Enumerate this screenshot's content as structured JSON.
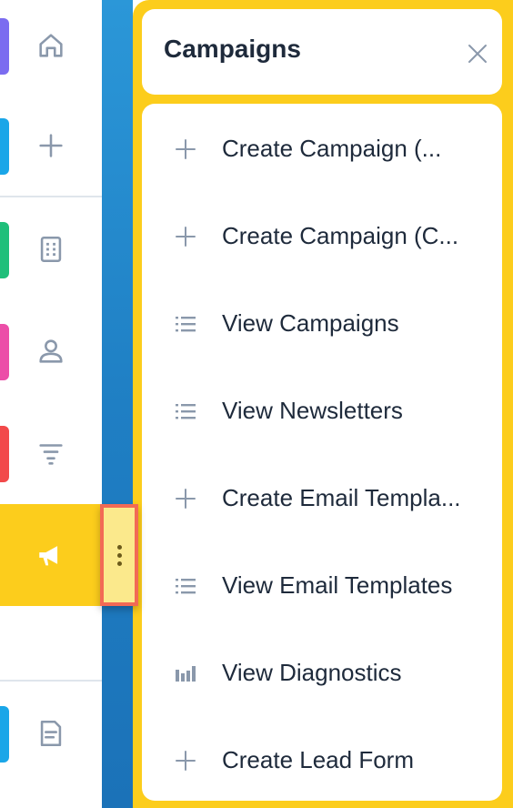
{
  "sidebar": {
    "items": [
      {
        "name": "home",
        "icon": "home-icon",
        "accent": "#7b6cf0"
      },
      {
        "name": "create",
        "icon": "plus-icon",
        "accent": "#1aa6e8"
      },
      {
        "name": "accounts",
        "icon": "building-icon",
        "accent": "#1fbf7a"
      },
      {
        "name": "contacts",
        "icon": "person-icon",
        "accent": "#ec4ea8"
      },
      {
        "name": "leads",
        "icon": "filter-icon",
        "accent": "#f2494a"
      },
      {
        "name": "campaigns",
        "icon": "megaphone-icon",
        "accent": "#fccd1c",
        "active": true
      },
      {
        "name": "documents",
        "icon": "document-icon",
        "accent": "#1aa6e8"
      }
    ]
  },
  "panel": {
    "title": "Campaigns",
    "items": [
      {
        "label": "Create Campaign (...",
        "icon": "plus-icon"
      },
      {
        "label": "Create Campaign (C...",
        "icon": "plus-icon"
      },
      {
        "label": "View Campaigns",
        "icon": "list-icon"
      },
      {
        "label": "View Newsletters",
        "icon": "list-icon"
      },
      {
        "label": "Create Email Templa...",
        "icon": "plus-icon"
      },
      {
        "label": "View Email Templates",
        "icon": "list-icon"
      },
      {
        "label": "View Diagnostics",
        "icon": "bar-chart-icon"
      },
      {
        "label": "Create Lead Form",
        "icon": "plus-icon"
      }
    ]
  },
  "colors": {
    "panel_yellow": "#fccd1c",
    "text_dark": "#1e2a3b",
    "icon_gray": "#8a98ab",
    "handle_border": "#f26a55"
  }
}
